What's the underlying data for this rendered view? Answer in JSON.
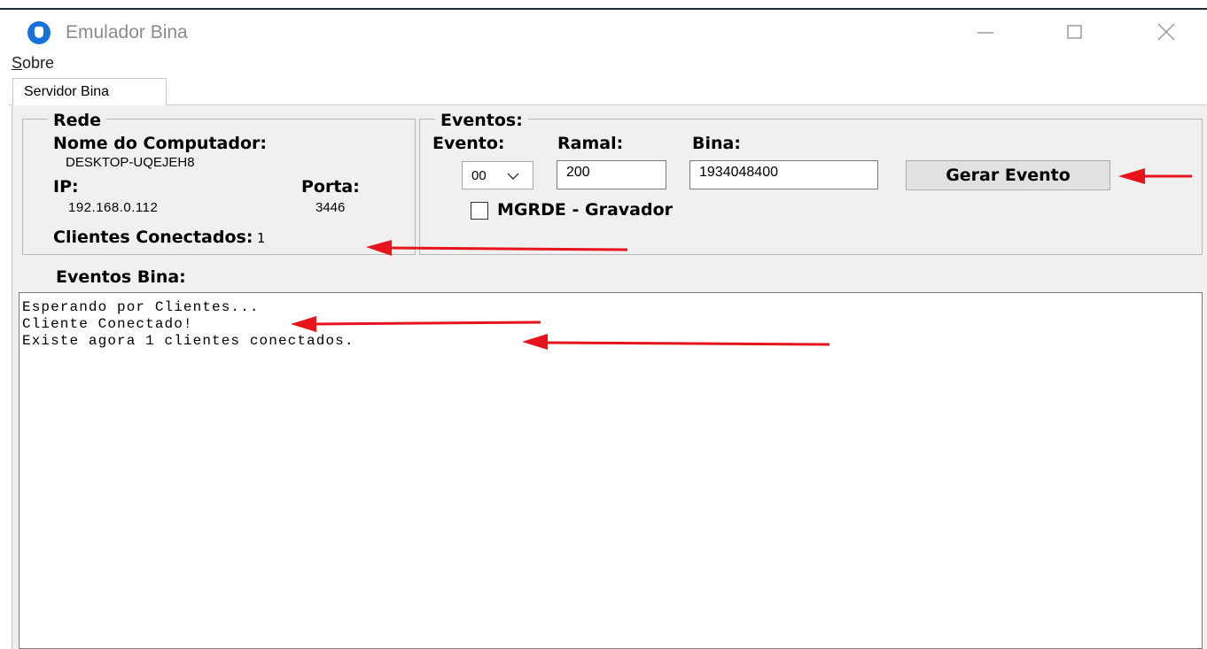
{
  "window": {
    "title": "Emulador Bina"
  },
  "menu": {
    "sobre_first": "S",
    "sobre_rest": "obre"
  },
  "tabs": [
    {
      "label": "Servidor Bina"
    }
  ],
  "rede": {
    "legend": "Rede",
    "computer_name_label": "Nome do Computador:",
    "computer_name_value": "DESKTOP-UQEJEH8",
    "ip_label": "IP:",
    "ip_value": "192.168.0.112",
    "porta_label": "Porta:",
    "porta_value": "3446",
    "clients_label": "Clientes Conectados:",
    "clients_value": "1"
  },
  "eventos": {
    "legend": "Eventos:",
    "evento_label": "Evento:",
    "evento_value": "00",
    "ramal_label": "Ramal:",
    "ramal_value": "200",
    "bina_label": "Bina:",
    "bina_value": "1934048400",
    "gerar_button": "Gerar Evento",
    "mgrde_label": "MGRDE - Gravador",
    "mgrde_checked": false
  },
  "eventos_bina": {
    "label": "Eventos Bina:",
    "lines": [
      "Esperando por Clientes...",
      "Cliente Conectado!",
      "Existe agora 1 clientes conectados."
    ]
  },
  "annotation_color": "#e8141b"
}
